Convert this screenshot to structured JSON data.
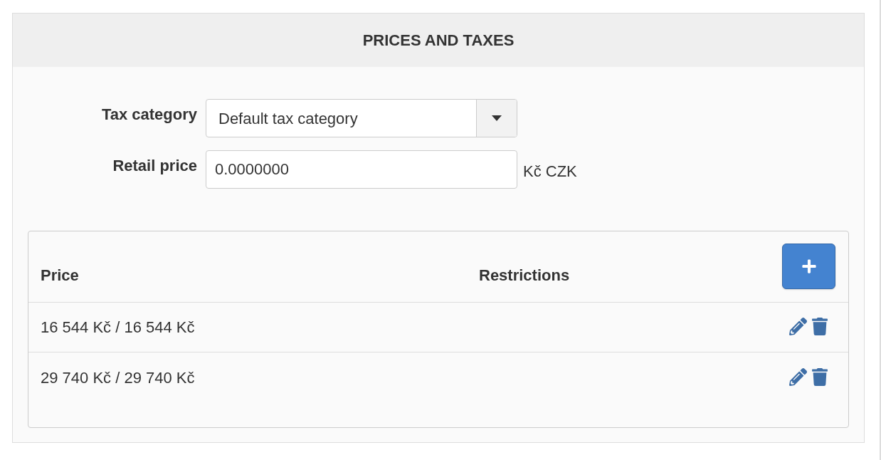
{
  "panel": {
    "title": "PRICES AND TAXES"
  },
  "form": {
    "fields": [
      {
        "kind": "select",
        "label": "Tax category",
        "value": "Default tax category"
      },
      {
        "kind": "input",
        "label": "Retail price",
        "value": "0.0000000",
        "suffix": "Kč CZK"
      }
    ]
  },
  "price_table": {
    "columns": [
      "Price",
      "Restrictions"
    ],
    "rows": [
      {
        "price": "16 544 Kč / 16 544 Kč"
      },
      {
        "price": "29 740 Kč / 29 740 Kč"
      }
    ]
  }
}
